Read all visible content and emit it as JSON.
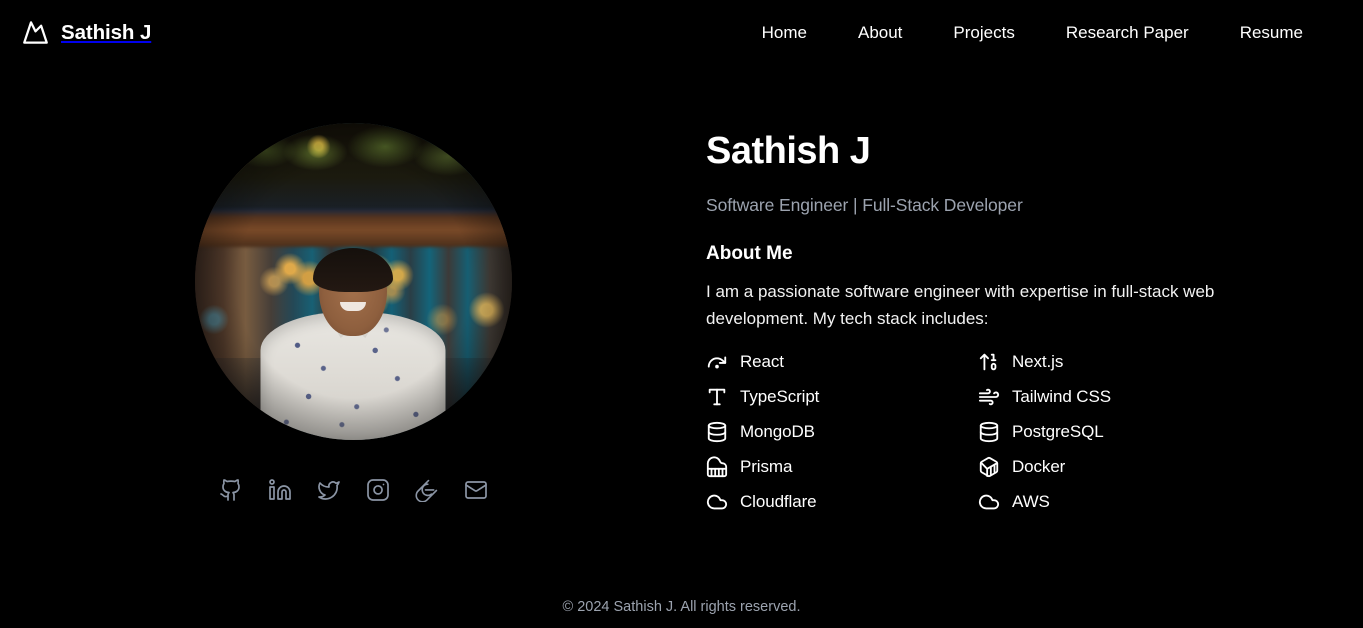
{
  "header": {
    "brand_name": "Sathish J",
    "logo_icon": "mountain-icon",
    "nav": [
      {
        "label": "Home",
        "name": "nav-link-home"
      },
      {
        "label": "About",
        "name": "nav-link-about"
      },
      {
        "label": "Projects",
        "name": "nav-link-projects"
      },
      {
        "label": "Research Paper",
        "name": "nav-link-research-paper"
      },
      {
        "label": "Resume",
        "name": "nav-link-resume"
      }
    ]
  },
  "profile": {
    "photo_alt": "Portrait of Sathish J smiling in a cafe with bokeh lights",
    "socials": [
      {
        "name": "github",
        "icon": "github-icon"
      },
      {
        "name": "linkedin",
        "icon": "linkedin-icon"
      },
      {
        "name": "twitter",
        "icon": "twitter-icon"
      },
      {
        "name": "instagram",
        "icon": "instagram-icon"
      },
      {
        "name": "geeksforgeeks",
        "icon": "geeksforgeeks-icon"
      },
      {
        "name": "email",
        "icon": "mail-icon"
      }
    ]
  },
  "hero": {
    "name": "Sathish J",
    "subtitle": "Software Engineer | Full-Stack Developer",
    "about_title": "About Me",
    "about_text": "I am a passionate software engineer with expertise in full-stack web development. My tech stack includes:"
  },
  "tech_stack": [
    {
      "label": "React",
      "icon": "redo-dot-icon"
    },
    {
      "label": "Next.js",
      "icon": "arrow-up-1-0-icon"
    },
    {
      "label": "TypeScript",
      "icon": "type-icon"
    },
    {
      "label": "Tailwind CSS",
      "icon": "wind-icon"
    },
    {
      "label": "MongoDB",
      "icon": "database-icon"
    },
    {
      "label": "PostgreSQL",
      "icon": "database-icon"
    },
    {
      "label": "Prisma",
      "icon": "piano-icon"
    },
    {
      "label": "Docker",
      "icon": "box-3d-icon"
    },
    {
      "label": "Cloudflare",
      "icon": "cloud-icon"
    },
    {
      "label": "AWS",
      "icon": "cloud-icon"
    }
  ],
  "footer": {
    "copyright": "© 2024 Sathish J. All rights reserved."
  },
  "colors": {
    "background": "#000000",
    "text_primary": "#ffffff",
    "text_muted": "#9ca3af",
    "social_icon": "#8b95a5"
  }
}
